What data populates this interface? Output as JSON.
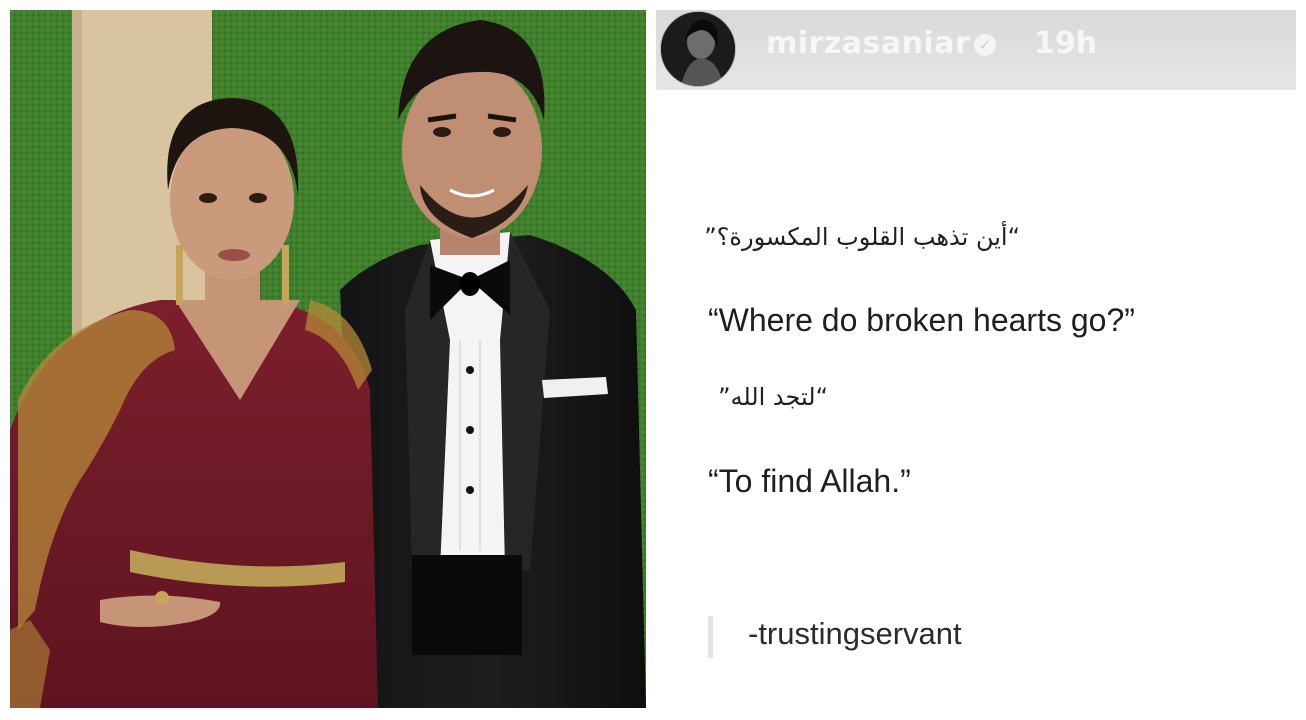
{
  "story": {
    "username": "mirzasaniar",
    "time_ago": "19h",
    "icons": {
      "verified": "verified-badge-icon"
    },
    "lines": [
      {
        "text": "“أين تذهب القلوب المكسورة؟”",
        "lang": "ar"
      },
      {
        "text": "“Where do broken hearts go?”",
        "lang": "en"
      },
      {
        "text": "“لتجد الله”",
        "lang": "ar"
      },
      {
        "text": "“To find Allah.”",
        "lang": "en"
      }
    ],
    "signature": "-trustingservant"
  },
  "colors": {
    "header_bg": "#dcdcdc",
    "header_text": "#f7f7f7",
    "quote_text": "#1f1f1f",
    "signature_bar": "#e4e4e4"
  }
}
